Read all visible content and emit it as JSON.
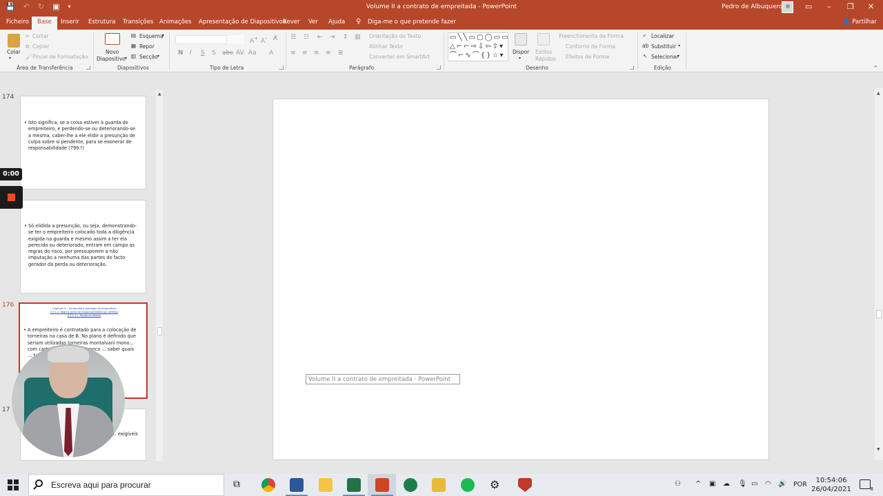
{
  "window": {
    "title": "Volume II a contrato de empreitada  -  PowerPoint",
    "user": "Pedro de Albuquerque"
  },
  "tabs": [
    "Ficheiro",
    "Base",
    "Inserir",
    "Estrutura",
    "Transições",
    "Animações",
    "Apresentação de Diapositivos",
    "Rever",
    "Ver",
    "Ajuda"
  ],
  "tellme": "Diga-me o que pretende fazer",
  "share": "Partilhar",
  "ribbon": {
    "clipboard": {
      "paste": "Colar",
      "cut": "Cortar",
      "copy": "Copiar",
      "format_painter": "Pincel de Formatação",
      "label": "Área de Transferência"
    },
    "slides": {
      "new_slide_1": "Novo",
      "new_slide_2": "Diapositivo",
      "layout": "Esquema",
      "reset": "Repor",
      "section": "Secção",
      "label": "Diapositivos"
    },
    "font": {
      "label": "Tipo de Letra"
    },
    "paragraph": {
      "text_direction": "Orientação do Texto",
      "align_text": "Alinhar Texto",
      "smartart": "Converter em SmartArt",
      "label": "Parágrafo"
    },
    "drawing": {
      "arrange": "Dispor",
      "quick_styles_1": "Estilos",
      "quick_styles_2": "Rápidos",
      "shape_fill": "Preenchimento da Forma",
      "shape_outline": "Contorno da Forma",
      "shape_effects": "Efeitos de Forma",
      "label": "Desenho"
    },
    "editing": {
      "find": "Localizar",
      "replace": "Substituir",
      "select": "Selecionar",
      "label": "Edição"
    }
  },
  "recorder": {
    "time": "0:00"
  },
  "slides": [
    {
      "number": "174",
      "text": "Isto significa, se a coisa estiver à guarda do empreiteiro, e perdendo-se ou deteriorando-se a mesma, caber-lhe a ele elidir a presunção de culpa sobre si pendente, para se exonerar de responsabilidade (799.º)"
    },
    {
      "number": "",
      "text": "Só elidida a presunção, ou seja, demonstrando-se ter o empreiteiro colocado toda a diligência exigida na guarda e mesmo assim a ter ela perecido ou deteriorado, entram em campo as regras do risco, por pressuporem a não imputação a nenhuma das partes do facto gerador da perda ou deterioração."
    },
    {
      "number": "176",
      "heading": [
        "Capítulo IV – Introdução à patologia da empreitada",
        "3.3.1.1. Regime geral da responsabilidade por defeitos",
        "3.3.1.1.1. Noção de defeito"
      ],
      "text": "A empreiteiro é contratado para a colocação de torneiras na casa de B. No plano é definido que seriam utilizadas torneiras montalvani mono... com cartucho ... modelo Branco ... saber quais ... tamento"
    },
    {
      "number": "17",
      "text": "... ...empreiteiro a ... de propor ação ... exigíveis no"
    }
  ],
  "tooltip": "Volume II a contrato de empreitada  -  PowerPoint",
  "taskbar": {
    "search_placeholder": "Escreva aqui para procurar",
    "language": "POR",
    "time": "10:54:06",
    "date": "26/04/2021",
    "notifications": "8"
  }
}
